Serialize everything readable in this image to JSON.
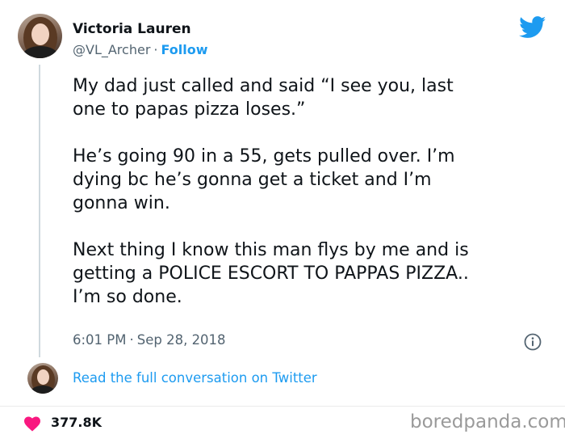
{
  "author": {
    "name": "Victoria Lauren",
    "handle": "@VL_Archer",
    "separator": "·",
    "follow_label": "Follow"
  },
  "tweet": {
    "text": "My dad just called and said “I see you, last\none to papas pizza loses.”\n\nHe’s going 90 in a 55, gets pulled over. I’m\ndying bc he’s gonna get a ticket and I’m\ngonna win.\n\nNext thing I know this man flys by me and is\ngetting a POLICE ESCORT TO PAPPAS PIZZA..\nI’m so done.",
    "time": "6:01 PM",
    "separator": "·",
    "date": "Sep 28, 2018"
  },
  "conversation_link": "Read the full conversation on Twitter",
  "likes": "377.8K",
  "watermark": "boredpanda.com",
  "icons": {
    "brand": "twitter-bird-icon",
    "info": "info-icon",
    "like": "heart-icon"
  },
  "colors": {
    "accent": "#1d9bf0",
    "text": "#0f1419",
    "muted": "#536471",
    "like": "#f91880"
  }
}
